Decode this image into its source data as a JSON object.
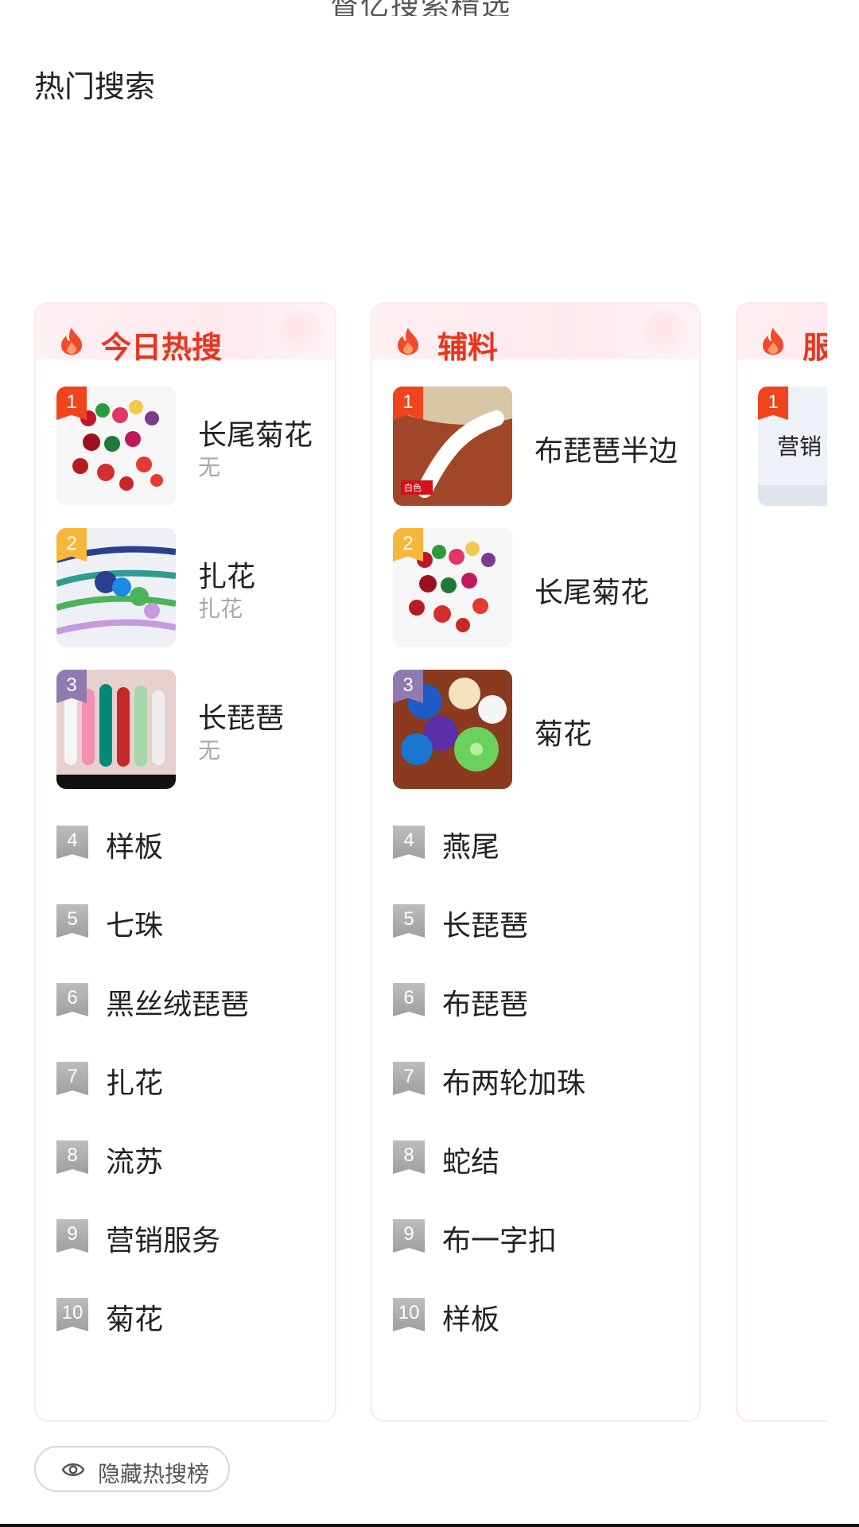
{
  "header": {
    "partial_title": "督亿搜索精选",
    "section_title": "热门搜索"
  },
  "boards": [
    {
      "title": "今日热搜",
      "top_items": [
        {
          "rank": "1",
          "name": "长尾菊花",
          "sub": "无"
        },
        {
          "rank": "2",
          "name": "扎花",
          "sub": "扎花"
        },
        {
          "rank": "3",
          "name": "长琵琶",
          "sub": "无"
        }
      ],
      "list_items": [
        {
          "rank": "4",
          "name": "样板"
        },
        {
          "rank": "5",
          "name": "七珠"
        },
        {
          "rank": "6",
          "name": "黑丝绒琵琶"
        },
        {
          "rank": "7",
          "name": "扎花"
        },
        {
          "rank": "8",
          "name": "流苏"
        },
        {
          "rank": "9",
          "name": "营销服务"
        },
        {
          "rank": "10",
          "name": "菊花"
        }
      ]
    },
    {
      "title": "辅料",
      "top_items": [
        {
          "rank": "1",
          "name": "布琵琶半边",
          "thumb_label": "白色"
        },
        {
          "rank": "2",
          "name": "长尾菊花"
        },
        {
          "rank": "3",
          "name": "菊花"
        }
      ],
      "list_items": [
        {
          "rank": "4",
          "name": "燕尾"
        },
        {
          "rank": "5",
          "name": "长琵琶"
        },
        {
          "rank": "6",
          "name": "布琵琶"
        },
        {
          "rank": "7",
          "name": "布两轮加珠"
        },
        {
          "rank": "8",
          "name": "蛇结"
        },
        {
          "rank": "9",
          "name": "布一字扣"
        },
        {
          "rank": "10",
          "name": "样板"
        }
      ]
    },
    {
      "title": "服",
      "top_items": [
        {
          "rank": "1",
          "thumb_text": "营销"
        }
      ]
    }
  ],
  "footer": {
    "hide_button_label": "隐藏热搜榜"
  },
  "colors": {
    "accent": "#e8361e",
    "rank1": "#f0441d",
    "rank2": "#f6b73c",
    "rank3": "#8f7bb0",
    "rank_gray": "#a8a8a8"
  },
  "icons": {
    "fire": "fire-icon",
    "eye": "eye-icon"
  }
}
